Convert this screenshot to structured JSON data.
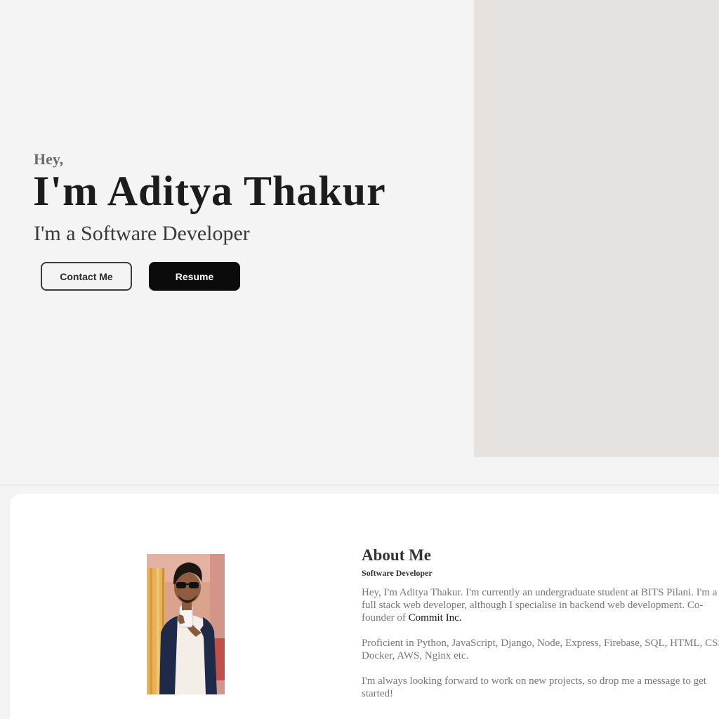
{
  "hero": {
    "greeting": "Hey,",
    "name": "I'm Aditya Thakur",
    "role": "I'm a Software Developer",
    "contact_label": "Contact Me",
    "resume_label": "Resume"
  },
  "about": {
    "title": "About Me",
    "subtitle": "Software Developer",
    "p1_before": "Hey, I'm Aditya Thakur. I'm currently an undergraduate student at BITS Pilani. I'm a full stack web developer, although I specialise in backend web development. Co-founder of ",
    "p1_link": "Commit Inc.",
    "p2": "Proficient in Python, JavaScript, Django, Node, Express, Firebase, SQL, HTML, CSS, Docker, AWS, Nginx etc.",
    "p3": "I'm always looking forward to work on new projects, so drop me a message to get started!"
  },
  "colors": {
    "page_bg": "#f4f4f4",
    "hero_panel": "#e6e2e0",
    "primary_button": "#0b0b0b",
    "card_bg": "#ffffff"
  }
}
